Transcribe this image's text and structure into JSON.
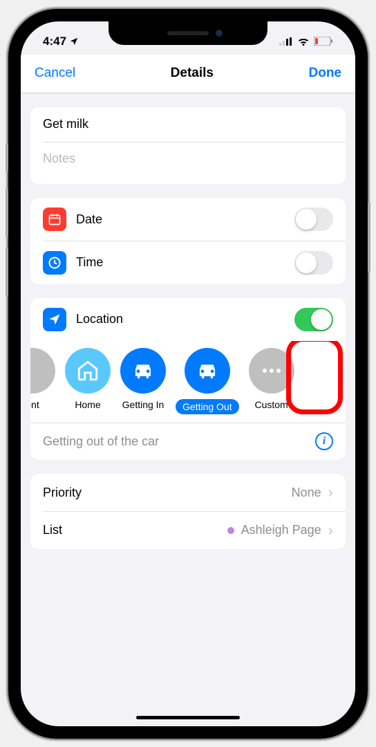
{
  "status_bar": {
    "time": "4:47"
  },
  "nav": {
    "cancel": "Cancel",
    "title": "Details",
    "done": "Done"
  },
  "reminder": {
    "title": "Get milk",
    "notes_placeholder": "Notes"
  },
  "rows": {
    "date": "Date",
    "time": "Time",
    "location": "Location",
    "priority_label": "Priority",
    "priority_value": "None",
    "list_label": "List",
    "list_value": "Ashleigh Page"
  },
  "location_options": {
    "partial": "ent",
    "home": "Home",
    "getting_in": "Getting In",
    "getting_out": "Getting Out",
    "custom": "Custom"
  },
  "location_detail": "Getting out of the car",
  "toggles": {
    "date": false,
    "time": false,
    "location": true
  },
  "colors": {
    "accent": "#007aff",
    "red": "#ff3b30",
    "green": "#34c759",
    "lightblue": "#5ac8fa",
    "highlight": "#ff0000",
    "list_dot": "#c183e6"
  }
}
